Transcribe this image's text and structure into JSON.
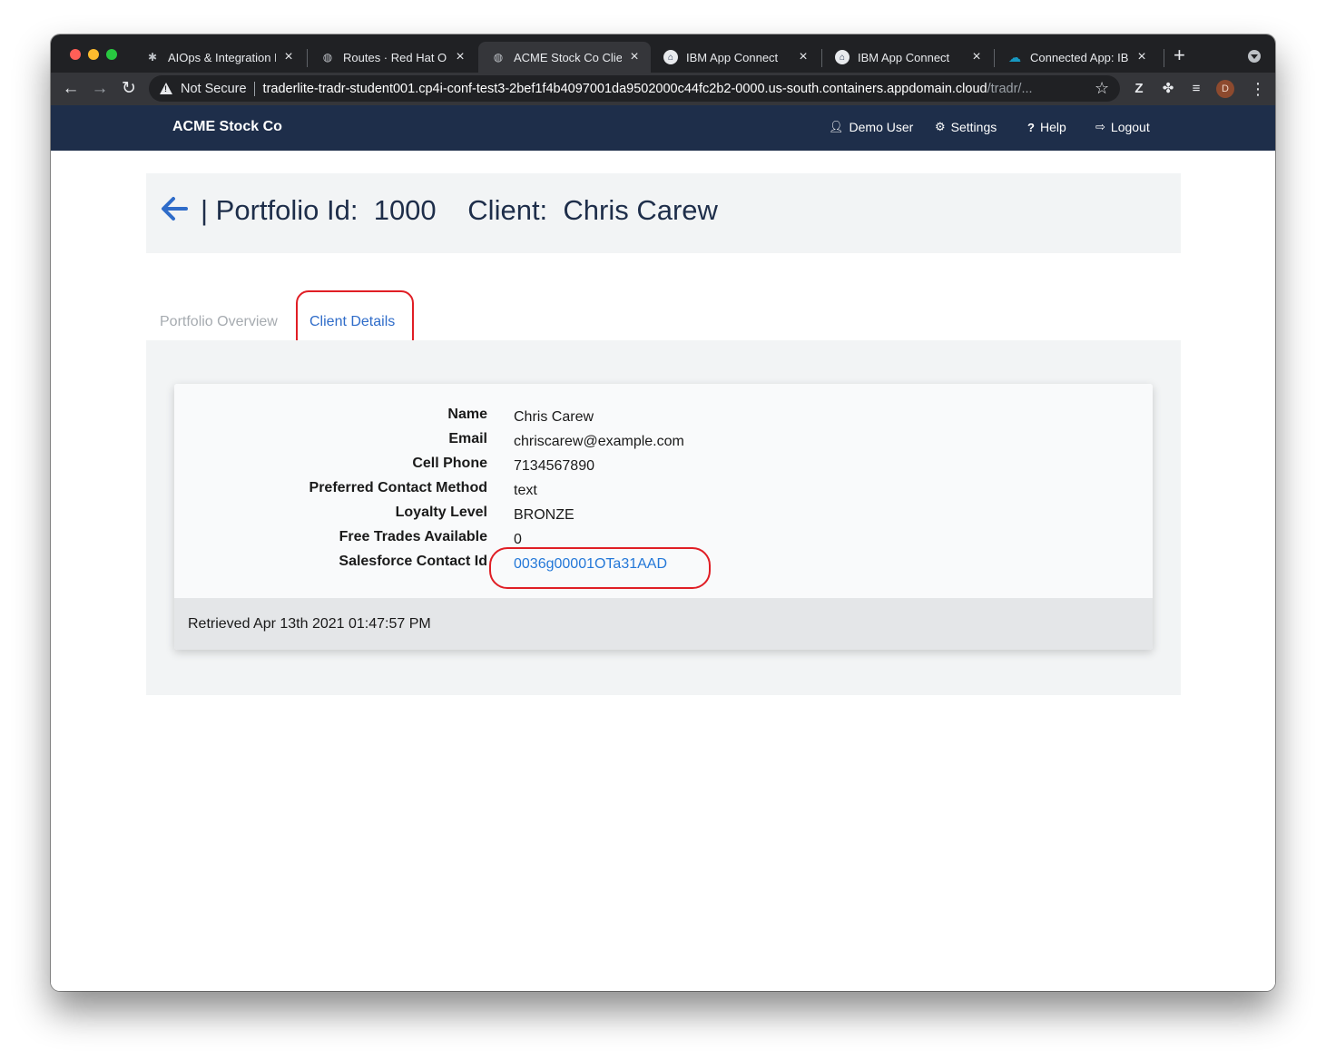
{
  "browser": {
    "tabs": [
      {
        "title": "AIOps & Integration Ex",
        "icon": "bee-icon"
      },
      {
        "title": "Routes · Red Hat Oper",
        "icon": "globe-icon"
      },
      {
        "title": "ACME Stock Co Client",
        "icon": "globe-icon",
        "active": true
      },
      {
        "title": "IBM App Connect",
        "icon": "app-connect-icon"
      },
      {
        "title": "IBM App Connect",
        "icon": "app-connect-icon"
      },
      {
        "title": "Connected App: IBM A",
        "icon": "salesforce-cloud-icon"
      }
    ],
    "security_label": "Not Secure",
    "url_host": "traderlite-tradr-student001.cp4i-conf-test3-2bef1f4b4097001da9502000c44fc2b2-0000.us-south.containers.appdomain.cloud",
    "url_path": "/tradr/...",
    "profile_initial": "D",
    "extension_z": "Z"
  },
  "navbar": {
    "brand": "ACME Stock Co",
    "items": [
      {
        "label": "Demo User",
        "icon": "user-icon"
      },
      {
        "label": "Settings",
        "icon": "gear-icon"
      },
      {
        "label": "Help",
        "icon": "question-icon"
      },
      {
        "label": "Logout",
        "icon": "logout-icon"
      }
    ]
  },
  "header": {
    "portfolio_label": "| Portfolio Id:",
    "portfolio_id": "1000",
    "client_label": "Client:",
    "client_name": "Chris Carew"
  },
  "tabs": {
    "overview": "Portfolio Overview",
    "details": "Client Details",
    "active": "details"
  },
  "client_details": {
    "rows": [
      {
        "label": "Name",
        "value": "Chris Carew"
      },
      {
        "label": "Email",
        "value": "chriscarew@example.com"
      },
      {
        "label": "Cell Phone",
        "value": "7134567890"
      },
      {
        "label": "Preferred Contact Method",
        "value": "text"
      },
      {
        "label": "Loyalty Level",
        "value": "BRONZE"
      },
      {
        "label": "Free Trades Available",
        "value": "0"
      },
      {
        "label": "Salesforce Contact Id",
        "value": "0036g00001OTa31AAD"
      }
    ],
    "retrieved": "Retrieved Apr 13th 2021 01:47:57 PM"
  },
  "colors": {
    "navbar_bg": "#1e2e4a",
    "accent_link": "#2478d8",
    "highlight_annotation": "#e01e25"
  }
}
